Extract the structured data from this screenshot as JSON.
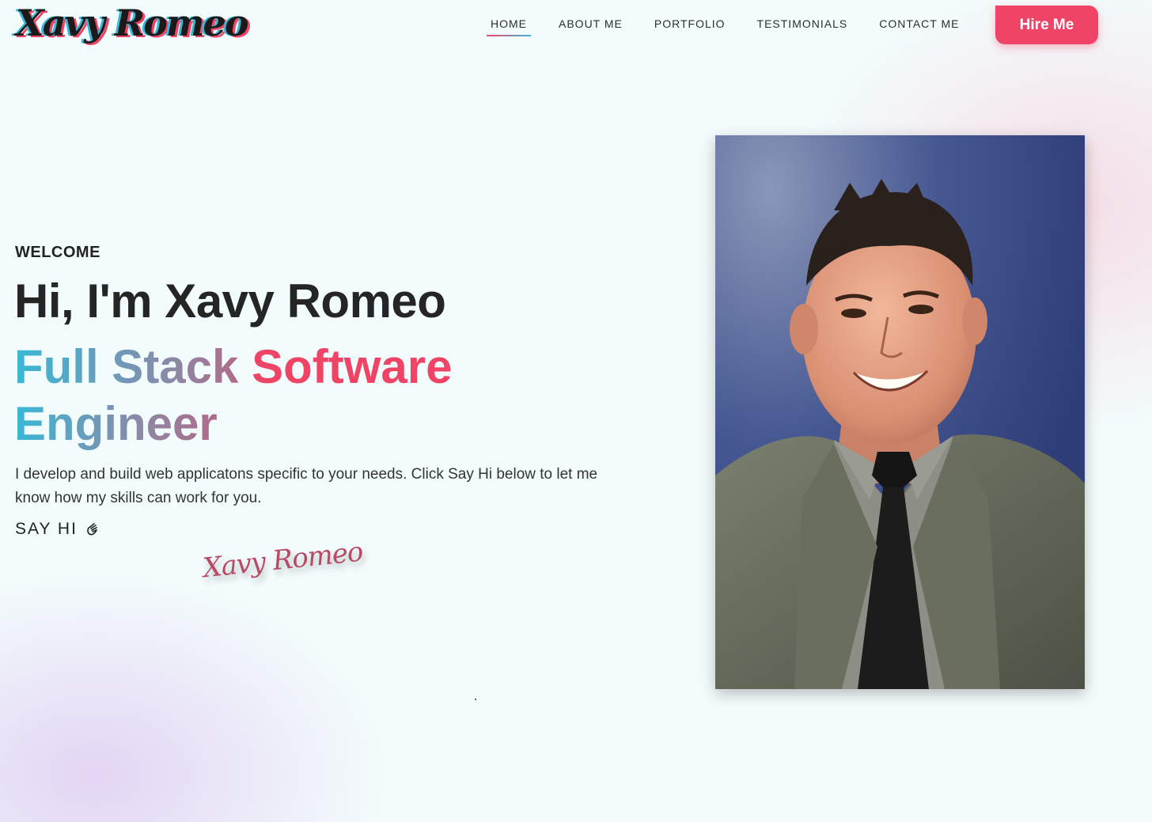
{
  "header": {
    "logo_text": "Xavy Romeo",
    "nav": [
      {
        "label": "HOME",
        "active": true
      },
      {
        "label": "ABOUT ME",
        "active": false
      },
      {
        "label": "PORTFOLIO",
        "active": false
      },
      {
        "label": "TESTIMONIALS",
        "active": false
      },
      {
        "label": "CONTACT ME",
        "active": false
      }
    ],
    "hire_label": "Hire Me"
  },
  "hero": {
    "eyebrow": "WELCOME",
    "headline": "Hi, I'm Xavy Romeo",
    "role_words": [
      "Full Stack",
      "Software",
      "Engineer"
    ],
    "description": "I develop and build web applicatons specific to your needs. Click Say Hi below to let me know how my skills can work for you.",
    "say_hi_label": "SAY HI",
    "say_hi_icon": "waving-hand-icon",
    "signature": "Xavy Romeo"
  },
  "photo": {
    "subject": "portrait-photo"
  },
  "colors": {
    "accent": "#ef4466",
    "accent_secondary": "#3ab7d6",
    "background": "#f3fcfc",
    "text": "#252525"
  }
}
